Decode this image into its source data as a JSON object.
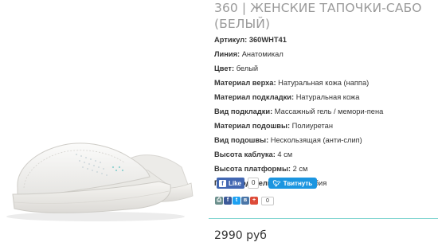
{
  "product": {
    "title_line1": "360 | ЖЕНСКИЕ ТАПОЧКИ-САБО",
    "title_line2": "(БЕЛЫЙ)",
    "specs": [
      {
        "key": "Артикул:",
        "value": "360WHT41",
        "value_bold": true
      },
      {
        "key": "Линия:",
        "value": "Анатомикал"
      },
      {
        "key": "Цвет:",
        "value": "белый"
      },
      {
        "key": "Материал верха:",
        "value": "Натуральная кожа (наппа)"
      },
      {
        "key": "Материал подкладки:",
        "value": "Натуральная кожа"
      },
      {
        "key": "Вид подкладки:",
        "value": "Массажный гель / мемори-пена"
      },
      {
        "key": "Материал подошвы:",
        "value": "Полиуретан"
      },
      {
        "key": "Вид подошвы:",
        "value": "Нескользящая (анти-слип)"
      },
      {
        "key": "Высота каблука:",
        "value": "4 см"
      },
      {
        "key": "Высота платформы:",
        "value": "2 см"
      },
      {
        "key": "Производитель:",
        "value": "LEON, Сербия"
      }
    ],
    "price": "2990 руб"
  },
  "social": {
    "fb_label": "Like",
    "fb_count": "0",
    "tw_label": "Твитнуть",
    "share_count": "0",
    "share_icons": [
      {
        "name": "print-icon",
        "color": "#6b8f8c",
        "glyph": "⎙"
      },
      {
        "name": "facebook-icon",
        "color": "#3b5998",
        "glyph": "f"
      },
      {
        "name": "twitter-icon",
        "color": "#1da1f2",
        "glyph": "t"
      },
      {
        "name": "vk-icon",
        "color": "#4a76a8",
        "glyph": "в"
      },
      {
        "name": "google-plus-icon",
        "color": "#dd4b39",
        "glyph": "+"
      }
    ]
  },
  "colors": {
    "title": "#9a9a9a",
    "divider": "#7fd4d0",
    "fb": "#4267b2",
    "tw": "#1b95e0"
  },
  "image": {
    "subject": "white leather clog slipper"
  }
}
